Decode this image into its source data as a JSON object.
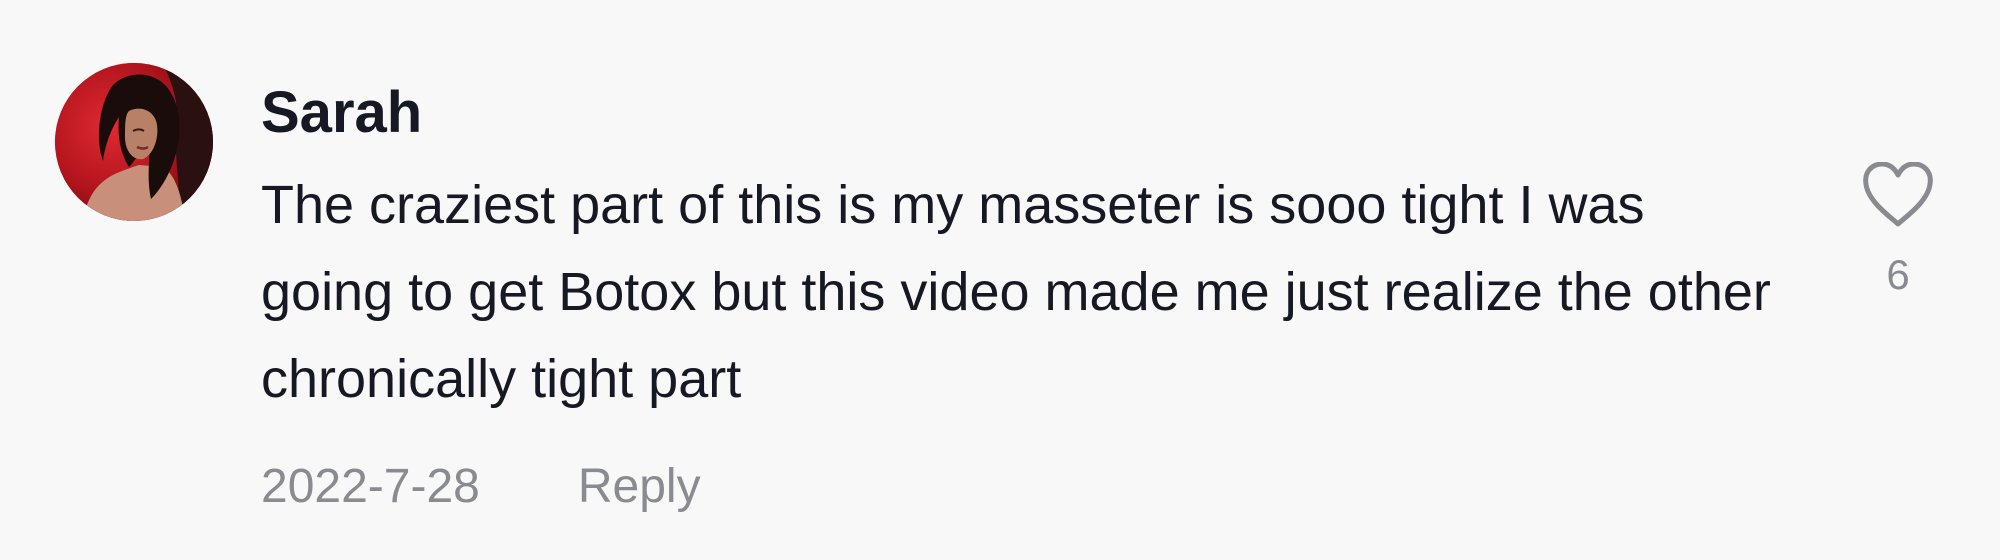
{
  "comment": {
    "username": "Sarah",
    "text": "The craziest part of this is my masseter is sooo tight I was going to get Botox but this video made me just realize the other chronically tight part",
    "date": "2022-7-28",
    "reply_label": "Reply",
    "like_count": "6",
    "avatar_icon": "user-avatar-photo",
    "like_icon": "heart-outline-icon"
  },
  "colors": {
    "background": "#f8f8f8",
    "primary_text": "#161823",
    "secondary_text": "#8a8b91"
  }
}
